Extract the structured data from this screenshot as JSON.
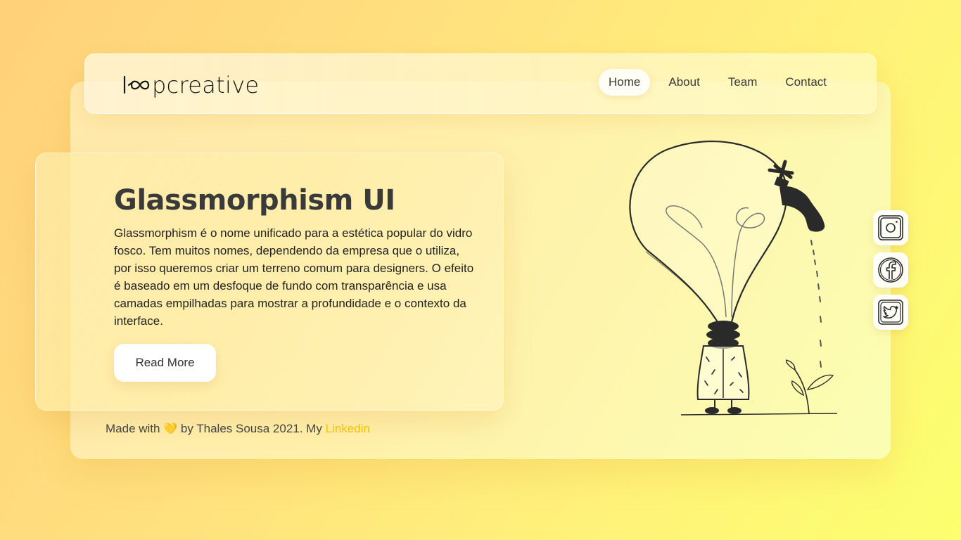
{
  "brand": {
    "logo_text": "pcreative"
  },
  "nav": {
    "items": [
      {
        "label": "Home",
        "active": true
      },
      {
        "label": "About"
      },
      {
        "label": "Team"
      },
      {
        "label": "Contact"
      }
    ]
  },
  "hero": {
    "title": "Glassmorphism UI",
    "description": "Glassmorphism é o nome unificado para a estética popular do vidro fosco. Tem muitos nomes, dependendo da empresa que o utiliza, por isso queremos criar um terreno comum para designers. O efeito é baseado em um desfoque de fundo com transparência e usa camadas empilhadas para mostrar a profundidade e o contexto da interface.",
    "button_label": "Read More"
  },
  "footer": {
    "prefix": "Made with",
    "heart": "💛",
    "middle": "by Thales Sousa 2021. My",
    "link_label": "Linkedin"
  },
  "social": [
    {
      "icon": "instagram-icon"
    },
    {
      "icon": "facebook-icon"
    },
    {
      "icon": "twitter-icon"
    }
  ],
  "colors": {
    "accent": "#f2c200",
    "text": "#333333",
    "background_start": "#ffd17a",
    "background_end": "#fcff6e"
  }
}
